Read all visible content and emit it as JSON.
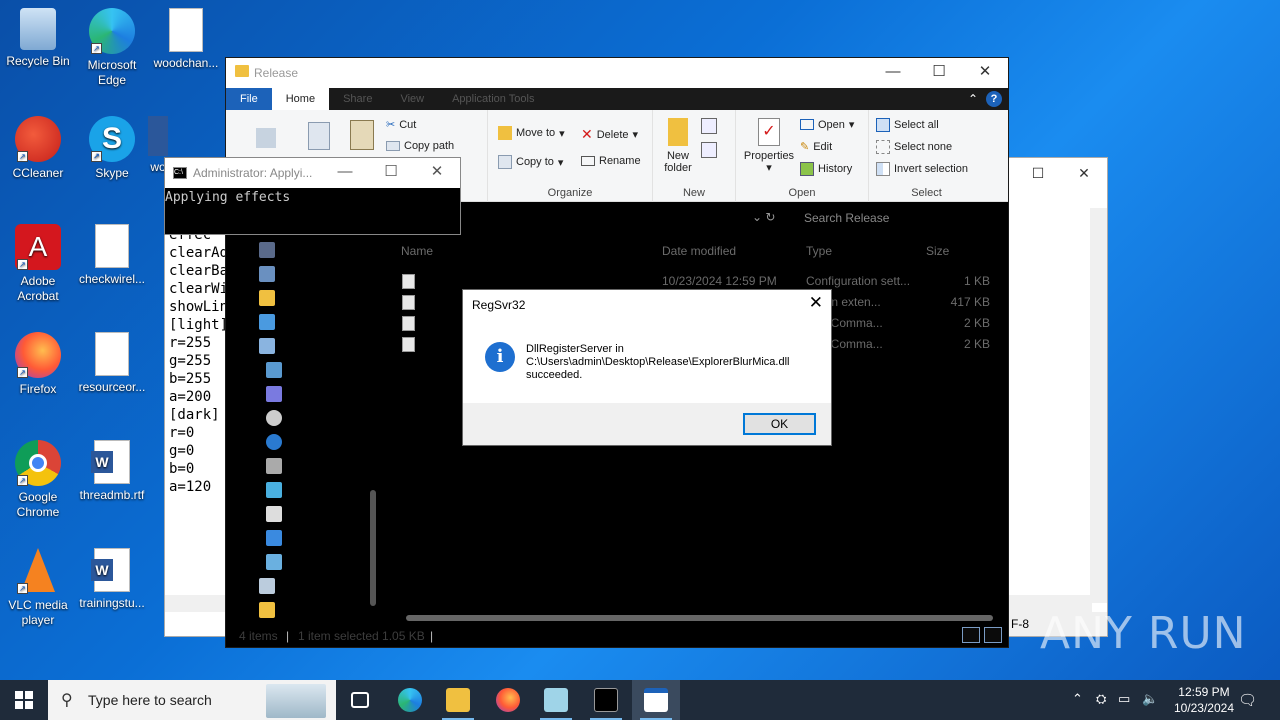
{
  "desktop": {
    "icons": [
      {
        "label": "Recycle Bin"
      },
      {
        "label": "Microsoft Edge"
      },
      {
        "label": "woodchan..."
      },
      {
        "label": "CCleaner"
      },
      {
        "label": "Skype"
      },
      {
        "label": "wo"
      },
      {
        "label": "Adobe Acrobat"
      },
      {
        "label": "checkwirel..."
      },
      {
        "label": "Firefox"
      },
      {
        "label": "resourceor..."
      },
      {
        "label": "Google Chrome"
      },
      {
        "label": "threadmb.rtf"
      },
      {
        "label": "VLC media player"
      },
      {
        "label": "trainingstu..."
      }
    ]
  },
  "notepad": {
    "lines": [
      "effec",
      "clearAd",
      "clearBa",
      "clearWi",
      "showLin",
      "[light]",
      "r=255",
      "g=255",
      "b=255",
      "a=200",
      "[dark]",
      "r=0",
      "g=0",
      "b=0",
      "a=120"
    ],
    "status_encoding": "F-8"
  },
  "explorer": {
    "title": "Release",
    "tabs": {
      "file": "File",
      "home": "Home",
      "share": "Share",
      "view": "View",
      "app_tools": "Application Tools"
    },
    "ribbon": {
      "cut": "Cut",
      "copy_path": "Copy path",
      "paste_shortcut": "cut",
      "move_to": "Move to",
      "copy_to": "Copy to",
      "delete": "Delete",
      "rename": "Rename",
      "organize": "Organize",
      "new_folder": "New folder",
      "new_group": "New",
      "properties": "Properties",
      "open": "Open",
      "edit": "Edit",
      "history": "History",
      "open_group": "Open",
      "select_all": "Select all",
      "select_none": "Select none",
      "invert_selection": "Invert selection",
      "select_group": "Select"
    },
    "search_placeholder": "Search Release",
    "columns": {
      "name": "Name",
      "date": "Date modified",
      "type": "Type",
      "size": "Size"
    },
    "files": [
      {
        "date": "10/23/2024 12:59 PM",
        "type": "Configuration sett...",
        "size": "1 KB"
      },
      {
        "date": "",
        "type": "cation exten...",
        "size": "417 KB"
      },
      {
        "date": "",
        "type": "ows Comma...",
        "size": "2 KB"
      },
      {
        "date": "",
        "type": "ows Comma...",
        "size": "2 KB"
      }
    ],
    "status": {
      "items": "4 items",
      "selected": "1 item selected  1.05 KB"
    }
  },
  "cmd": {
    "title": "Administrator: Applyi...",
    "output": "Applying effects"
  },
  "dialog": {
    "title": "RegSvr32",
    "message_line1": "DllRegisterServer in",
    "message_line2": "C:\\Users\\admin\\Desktop\\Release\\ExplorerBlurMica.dll",
    "message_line3": "succeeded.",
    "ok": "OK"
  },
  "taskbar": {
    "search_placeholder": "Type here to search",
    "time": "12:59 PM",
    "date": "10/23/2024"
  },
  "watermark": "ANY RUN",
  "colors": {
    "accent": "#0078d7",
    "file_tab": "#1c62b9",
    "taskbar": "#1f2b3a"
  }
}
